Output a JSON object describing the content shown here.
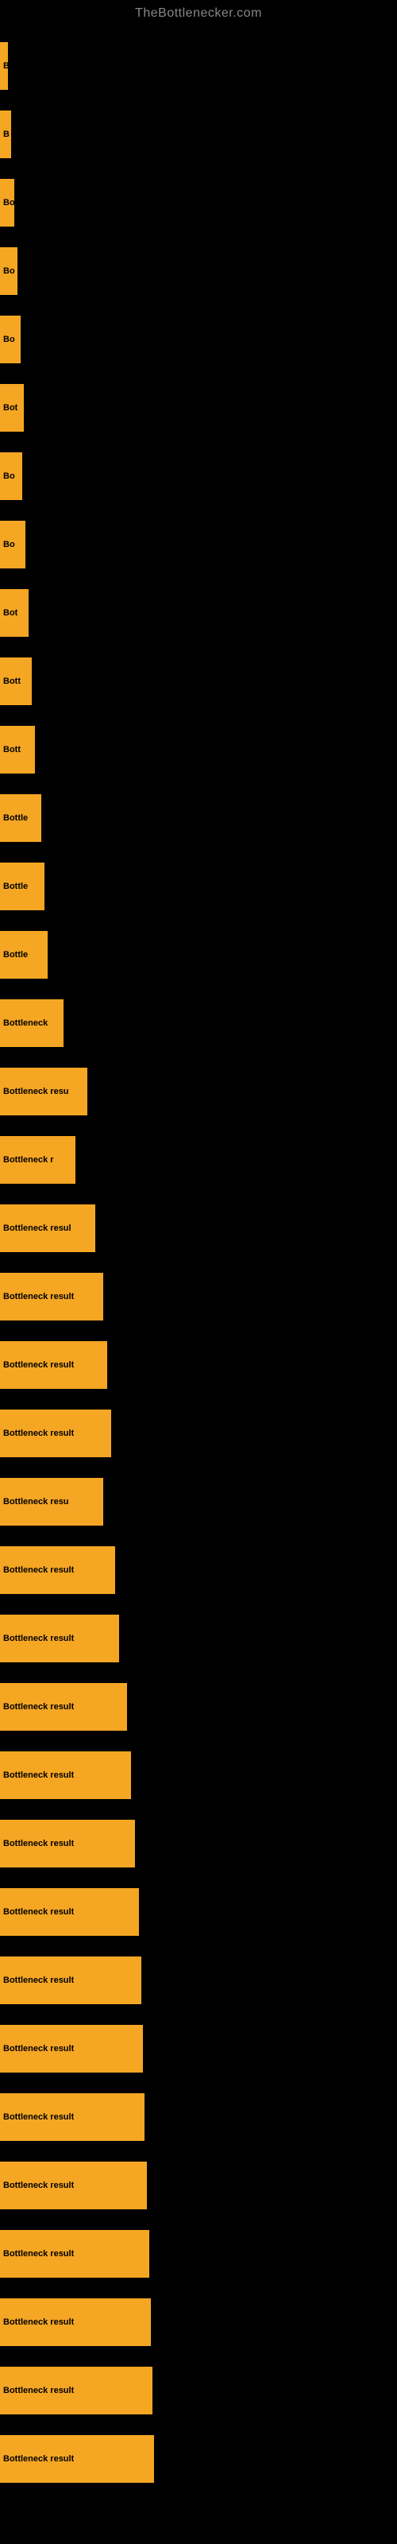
{
  "site": {
    "title": "TheBottlenecker.com"
  },
  "bars": [
    {
      "label": "B",
      "width": 10
    },
    {
      "label": "B",
      "width": 14
    },
    {
      "label": "Bo",
      "width": 18
    },
    {
      "label": "Bo",
      "width": 22
    },
    {
      "label": "Bo",
      "width": 26
    },
    {
      "label": "Bot",
      "width": 30
    },
    {
      "label": "Bo",
      "width": 28
    },
    {
      "label": "Bo",
      "width": 32
    },
    {
      "label": "Bot",
      "width": 36
    },
    {
      "label": "Bott",
      "width": 40
    },
    {
      "label": "Bott",
      "width": 44
    },
    {
      "label": "Bottle",
      "width": 52
    },
    {
      "label": "Bottle",
      "width": 56
    },
    {
      "label": "Bottle",
      "width": 60
    },
    {
      "label": "Bottleneck",
      "width": 80
    },
    {
      "label": "Bottleneck resu",
      "width": 110
    },
    {
      "label": "Bottleneck r",
      "width": 95
    },
    {
      "label": "Bottleneck resul",
      "width": 120
    },
    {
      "label": "Bottleneck result",
      "width": 130
    },
    {
      "label": "Bottleneck result",
      "width": 135
    },
    {
      "label": "Bottleneck result",
      "width": 140
    },
    {
      "label": "Bottleneck resu",
      "width": 130
    },
    {
      "label": "Bottleneck result",
      "width": 145
    },
    {
      "label": "Bottleneck result",
      "width": 150
    },
    {
      "label": "Bottleneck result",
      "width": 160
    },
    {
      "label": "Bottleneck result",
      "width": 165
    },
    {
      "label": "Bottleneck result",
      "width": 170
    },
    {
      "label": "Bottleneck result",
      "width": 175
    },
    {
      "label": "Bottleneck result",
      "width": 178
    },
    {
      "label": "Bottleneck result",
      "width": 180
    },
    {
      "label": "Bottleneck result",
      "width": 182
    },
    {
      "label": "Bottleneck result",
      "width": 185
    },
    {
      "label": "Bottleneck result",
      "width": 188
    },
    {
      "label": "Bottleneck result",
      "width": 190
    },
    {
      "label": "Bottleneck result",
      "width": 192
    },
    {
      "label": "Bottleneck result",
      "width": 194
    }
  ]
}
